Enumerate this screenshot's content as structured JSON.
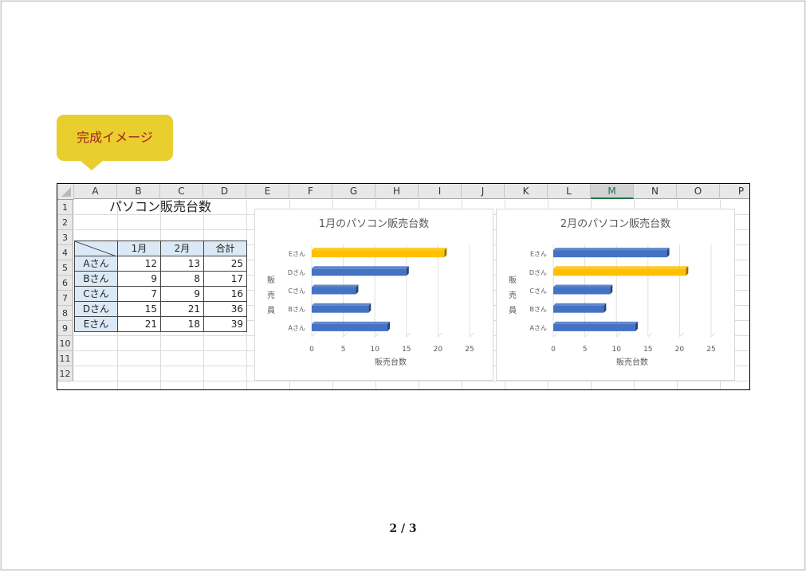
{
  "callout": {
    "label": "完成イメージ"
  },
  "sheet": {
    "columns": [
      "A",
      "B",
      "C",
      "D",
      "E",
      "F",
      "G",
      "H",
      "I",
      "J",
      "K",
      "L",
      "M",
      "N",
      "O",
      "P"
    ],
    "selected_column": "M",
    "rows": [
      "1",
      "2",
      "3",
      "4",
      "5",
      "6",
      "7",
      "8",
      "9",
      "10",
      "11",
      "12"
    ],
    "title": "パソコン販売台数",
    "table": {
      "headers": [
        "1月",
        "2月",
        "合計"
      ],
      "rows": [
        {
          "name": "Aさん",
          "jan": 12,
          "feb": 13,
          "total": 25
        },
        {
          "name": "Bさん",
          "jan": 9,
          "feb": 8,
          "total": 17
        },
        {
          "name": "Cさん",
          "jan": 7,
          "feb": 9,
          "total": 16
        },
        {
          "name": "Dさん",
          "jan": 15,
          "feb": 21,
          "total": 36
        },
        {
          "name": "Eさん",
          "jan": 21,
          "feb": 18,
          "total": 39
        }
      ]
    }
  },
  "chart_data": [
    {
      "type": "bar",
      "title": "1月のパソコン販売台数",
      "categories": [
        "Aさん",
        "Bさん",
        "Cさん",
        "Dさん",
        "Eさん"
      ],
      "values": [
        12,
        9,
        7,
        15,
        21
      ],
      "highlight": "Eさん",
      "xlabel": "販売台数",
      "ylabel": "販売員",
      "xlim": [
        0,
        25
      ],
      "xticks": [
        0,
        5,
        10,
        15,
        20,
        25
      ],
      "bar_color": "#4472c4",
      "highlight_color": "#ffc000"
    },
    {
      "type": "bar",
      "title": "2月のパソコン販売台数",
      "categories": [
        "Aさん",
        "Bさん",
        "Cさん",
        "Dさん",
        "Eさん"
      ],
      "values": [
        13,
        8,
        9,
        21,
        18
      ],
      "highlight": "Dさん",
      "xlabel": "販売台数",
      "ylabel": "販売員",
      "xlim": [
        0,
        25
      ],
      "xticks": [
        0,
        5,
        10,
        15,
        20,
        25
      ],
      "bar_color": "#4472c4",
      "highlight_color": "#ffc000"
    }
  ],
  "footer": {
    "page": "2 / 3"
  }
}
